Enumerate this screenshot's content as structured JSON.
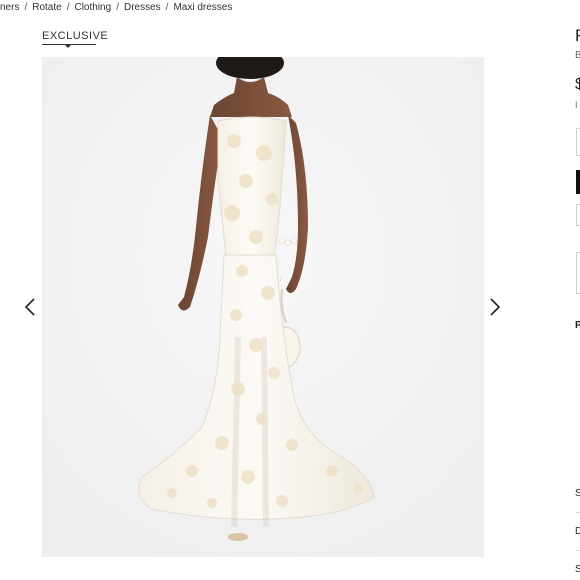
{
  "breadcrumb": [
    "ners",
    "Rotate",
    "Clothing",
    "Dresses",
    "Maxi dresses"
  ],
  "badge": "EXCLUSIVE",
  "gallery": {
    "prev_icon": "chevron-left-icon",
    "next_icon": "chevron-right-icon"
  },
  "sidebar": {
    "title_fragment": "R",
    "brand_fragment": "B",
    "price_fragment": "$",
    "note_fragment": "I",
    "section_p": "P",
    "section_s": "S",
    "section_d": "D",
    "section_s2": "S"
  },
  "colors": {
    "background": "#ffffff",
    "gallery_bg": "#f3f3f4",
    "text": "#222222"
  }
}
